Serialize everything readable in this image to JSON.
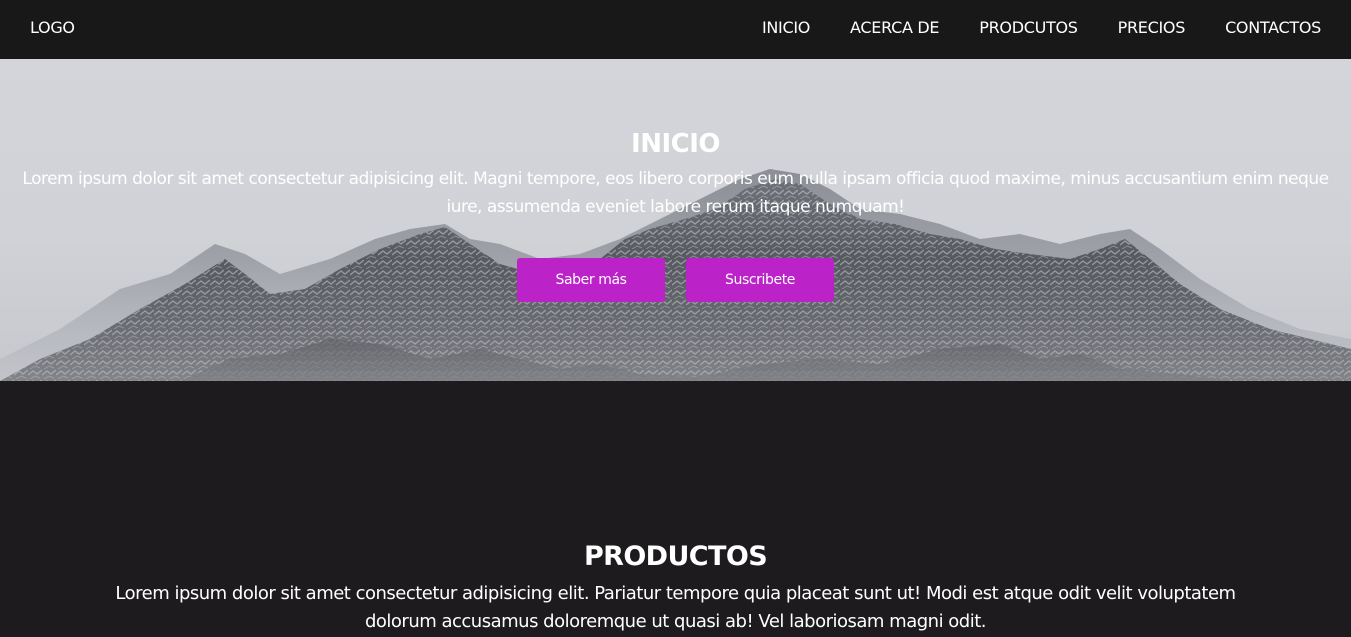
{
  "nav": {
    "logo": "LOGO",
    "links": [
      "INICIO",
      "ACERCA DE",
      "PRODCUTOS",
      "PRECIOS",
      "CONTACTOS"
    ]
  },
  "hero": {
    "title": "INICIO",
    "text": "Lorem ipsum dolor sit amet consectetur adipisicing elit. Magni tempore, eos libero corporis eum nulla ipsam officia quod maxime, minus accusantium enim neque iure, assumenda eveniet labore rerum itaque numquam!",
    "buttons": {
      "more": "Saber más",
      "subscribe": "Suscribete"
    }
  },
  "products": {
    "title": "PRODUCTOS",
    "text": "Lorem ipsum dolor sit amet consectetur adipisicing elit. Pariatur tempore quia placeat sunt ut! Modi est atque odit velit voluptatem dolorum accusamus doloremque ut quasi ab! Vel laboriosam magni odit."
  },
  "colors": {
    "navbar_bg": "#181818",
    "page_bg": "#1d1b1d",
    "accent": "#bb22c8",
    "text": "#ffffff"
  }
}
